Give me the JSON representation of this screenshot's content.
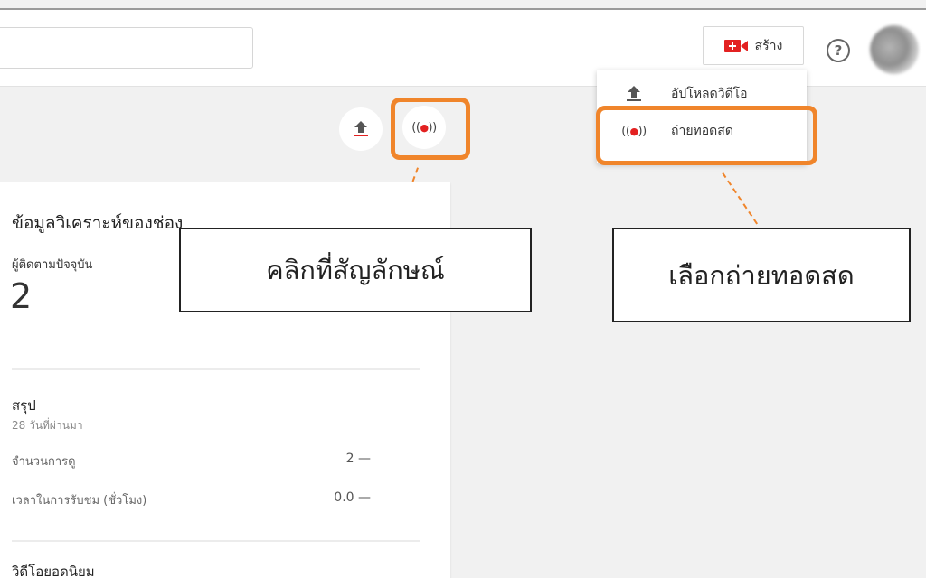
{
  "header": {
    "search_placeholder": "",
    "create_label": "สร้าง",
    "help_symbol": "?"
  },
  "create_menu": {
    "items": [
      {
        "label": "อัปโหลดวิดีโอ",
        "icon": "upload-icon"
      },
      {
        "label": "ถ่ายทอดสด",
        "icon": "live-broadcast-icon"
      }
    ]
  },
  "toolbar": {
    "upload_icon": "upload-icon",
    "live_icon": "live-broadcast-icon"
  },
  "analytics": {
    "title": "ข้อมูลวิเคราะห์ของช่อง",
    "subscribers_label": "ผู้ติดตามปัจจุบัน",
    "subscribers_value": "2",
    "summary_title": "สรุป",
    "summary_period": "28 วันที่ผ่านมา",
    "rows": [
      {
        "label": "จำนวนการดู",
        "value": "2 —"
      },
      {
        "label": "เวลาในการรับชม (ชั่วโมง)",
        "value": "0.0 —"
      }
    ],
    "popular_title": "วิดีโอยอดนิยม"
  },
  "callouts": {
    "click_icon": "คลิกที่สัญลักษณ์",
    "choose_live": "เลือกถ่ายทอดสด"
  },
  "colors": {
    "highlight": "#f0852b",
    "live_red": "#e32121"
  }
}
